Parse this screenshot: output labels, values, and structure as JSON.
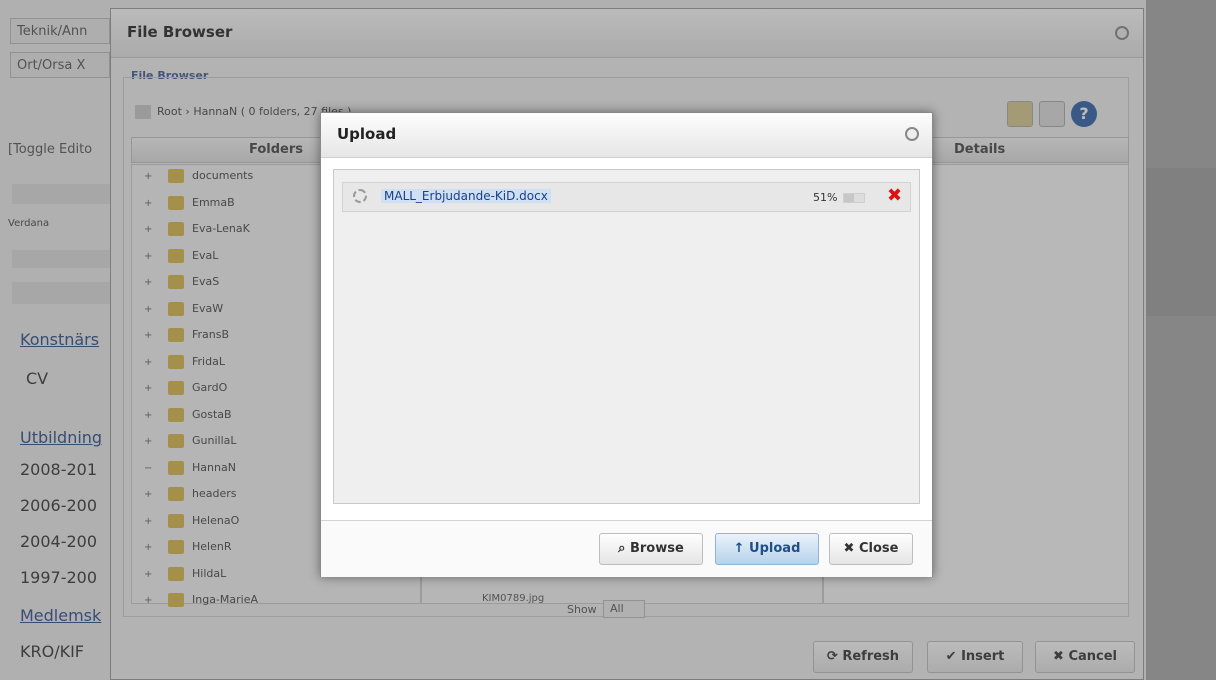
{
  "background": {
    "fields": [
      "Teknik/Ann",
      "Ort/Orsa X"
    ],
    "toggle_editor": "[Toggle Edito",
    "font_name": "Verdana",
    "section_konstnar": "Konstnärs",
    "cv": "CV",
    "section_utbildning": "Utbildning",
    "years": [
      "2008-201",
      "2006-200",
      "2004-200",
      "1997-200"
    ],
    "section_medlemskap": "Medlemsk",
    "kro": "KRO/KIF"
  },
  "file_browser": {
    "title": "File Browser",
    "fieldset_label": "File Browser",
    "path": "Root › HannaN  ( 0 folders, 27 files )",
    "folders_header": "Folders",
    "details_header": "Details",
    "folders": [
      "documents",
      "EmmaB",
      "Eva-LenaK",
      "EvaL",
      "EvaS",
      "EvaW",
      "FransB",
      "FridaL",
      "GardO",
      "GostaB",
      "GunillaL",
      "HannaN",
      "headers",
      "HelenaO",
      "HelenR",
      "HildaL",
      "Inga-MarieA"
    ],
    "folder_expanders": [
      "+",
      "+",
      "+",
      "+",
      "+",
      "+",
      "+",
      "+",
      "+",
      "+",
      "+",
      "−",
      "+",
      "+",
      "+",
      "+",
      "+"
    ],
    "partial_file": "KIM0789.jpg",
    "show_label": "Show",
    "show_value": "All",
    "refresh_label": "Refresh",
    "insert_label": "Insert",
    "cancel_label": "Cancel"
  },
  "upload_dialog": {
    "title": "Upload",
    "file": {
      "name": "MALL_Erbjudande-KiD.docx",
      "progress_text": "51%",
      "progress": 0.51
    },
    "browse_label": "Browse",
    "upload_label": "Upload",
    "close_label": "Close"
  }
}
